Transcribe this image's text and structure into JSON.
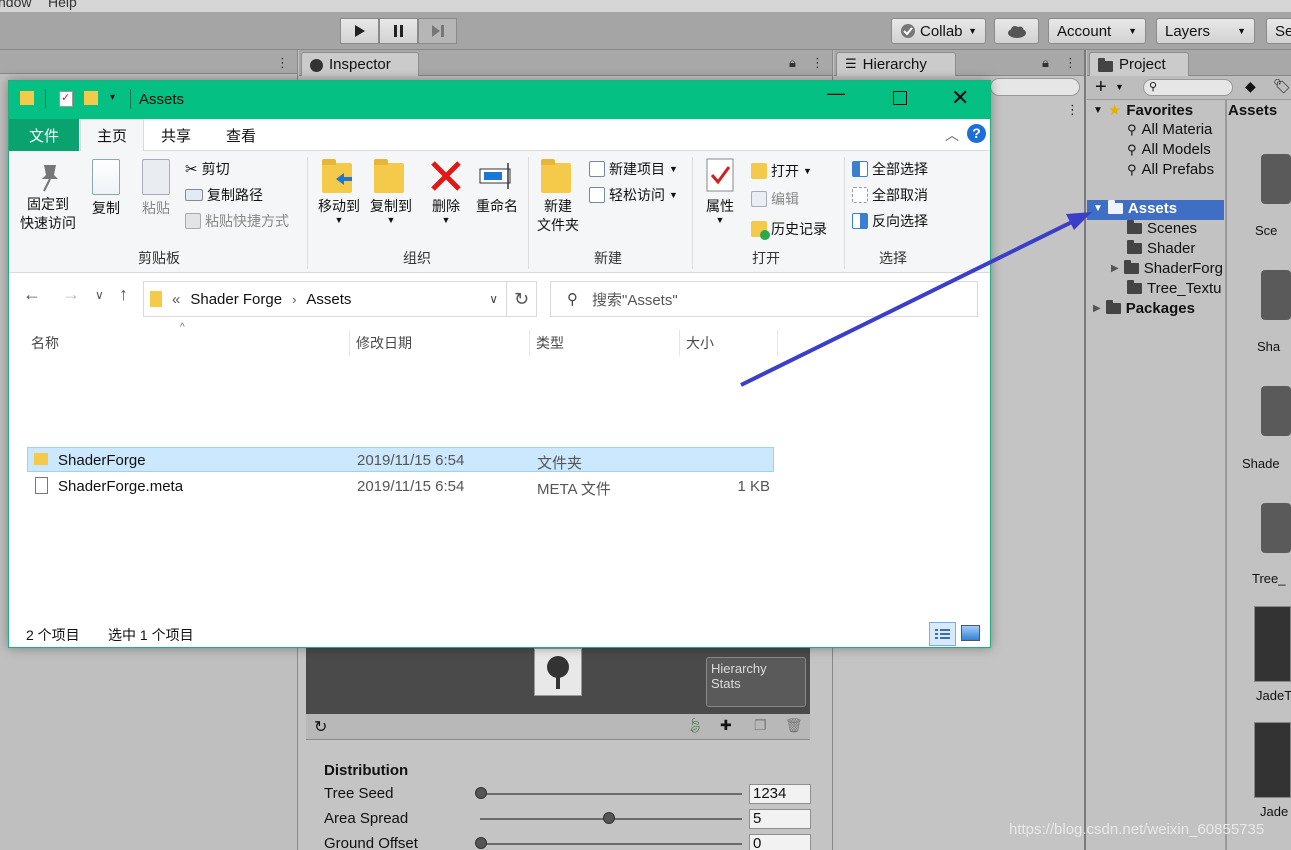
{
  "unity": {
    "menu": [
      "ndow",
      "Help"
    ],
    "toolbar": {
      "collab_label": "Collab",
      "account_label": "Account",
      "layers_label": "Layers",
      "layout_label": "Se"
    },
    "inspector": {
      "tab_label": "Inspector",
      "hierarchy_stats_line1": "Hierarchy",
      "hierarchy_stats_line2": "Stats",
      "section_title": "Distribution",
      "fields": [
        {
          "label": "Tree Seed",
          "value": "1234",
          "slider_fraction": 0.0
        },
        {
          "label": "Area Spread",
          "value": "5",
          "slider_fraction": 0.49
        },
        {
          "label": "Ground Offset",
          "value": "0",
          "slider_fraction": 0.0
        }
      ]
    },
    "hierarchy": {
      "tab_label": "Hierarchy"
    },
    "project": {
      "tab_label": "Project",
      "favorites_label": "Favorites",
      "favorites": [
        "All Materia",
        "All Models",
        "All Prefabs"
      ],
      "assets_label": "Assets",
      "assets_children": [
        "Scenes",
        "Shader",
        "ShaderForg",
        "Tree_Textu"
      ],
      "packages_label": "Packages",
      "grid_header": "Assets",
      "grid_items": [
        "Sce",
        "Sha",
        "Shade",
        "Tree_",
        "JadeT",
        "Jade"
      ]
    }
  },
  "explorer": {
    "title": "Assets",
    "tabs": {
      "file": "文件",
      "home": "主页",
      "share": "共享",
      "view": "查看"
    },
    "ribbon": {
      "clipboard": {
        "pin_line1": "固定到",
        "pin_line2": "快速访问",
        "copy": "复制",
        "paste": "粘贴",
        "cut": "剪切",
        "copy_path": "复制路径",
        "paste_shortcut": "粘贴快捷方式",
        "group_label": "剪贴板"
      },
      "organize": {
        "move_to": "移动到",
        "copy_to": "复制到",
        "delete": "删除",
        "rename": "重命名",
        "group_label": "组织"
      },
      "new": {
        "new_folder_line1": "新建",
        "new_folder_line2": "文件夹",
        "new_item": "新建项目",
        "easy_access": "轻松访问",
        "group_label": "新建"
      },
      "open": {
        "properties": "属性",
        "open": "打开",
        "edit": "编辑",
        "history": "历史记录",
        "group_label": "打开"
      },
      "select": {
        "select_all": "全部选择",
        "select_none": "全部取消",
        "invert": "反向选择",
        "group_label": "选择"
      }
    },
    "address": {
      "prefix": "«",
      "crumbs": [
        "Shader Forge",
        "Assets"
      ],
      "search_placeholder": "搜索\"Assets\""
    },
    "columns": {
      "name": "名称",
      "date": "修改日期",
      "type": "类型",
      "size": "大小"
    },
    "files": [
      {
        "name": "ShaderForge",
        "date": "2019/11/15 6:54",
        "type": "文件夹",
        "size": "",
        "selected": true
      },
      {
        "name": "ShaderForge.meta",
        "date": "2019/11/15 6:54",
        "type": "META 文件",
        "size": "1 KB",
        "selected": false
      }
    ],
    "status": {
      "count": "2 个项目",
      "selected": "选中 1 个项目"
    }
  },
  "watermark": "https://blog.csdn.net/weixin_60855735",
  "colors": {
    "titlebar": "#04c082",
    "file_tab": "#0aa36f",
    "selection": "#cce8ff",
    "unity_selected": "#3e6fc4",
    "arrow": "#3b3fc8"
  }
}
